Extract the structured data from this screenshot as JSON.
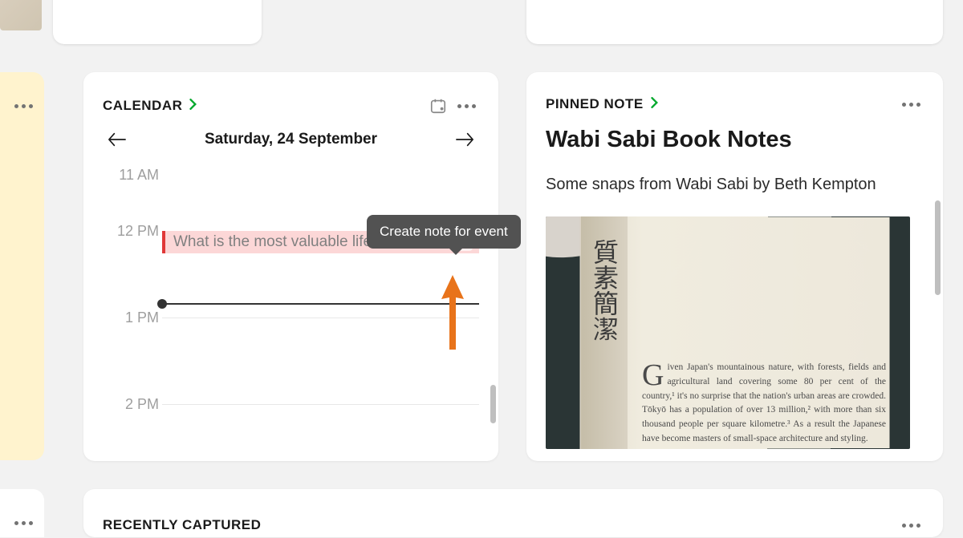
{
  "calendar": {
    "title": "CALENDAR",
    "date_label": "Saturday, 24 September",
    "hours": [
      "11 AM",
      "12 PM",
      "1 PM",
      "2 PM"
    ],
    "event_title": "What is the most valuable life lesson...",
    "tooltip": "Create note for event"
  },
  "pinned": {
    "title": "PINNED NOTE",
    "note_title": "Wabi Sabi Book Notes",
    "subtitle": "Some snaps from Wabi Sabi by Beth Kempton",
    "kanji": "質素簡潔",
    "book_excerpt_first": "G",
    "book_excerpt": "iven Japan's mountainous nature, with forests, fields and agricultural land covering some 80 per cent of the country,¹ it's no surprise that the nation's urban areas are crowded. Tōkyō has a population of over 13 million,² with more than six thousand people per square kilometre.³ As a result the Japanese have become masters of small-space architecture and styling."
  },
  "recent": {
    "title": "RECENTLY CAPTURED"
  },
  "colors": {
    "accent": "#00a82d"
  }
}
